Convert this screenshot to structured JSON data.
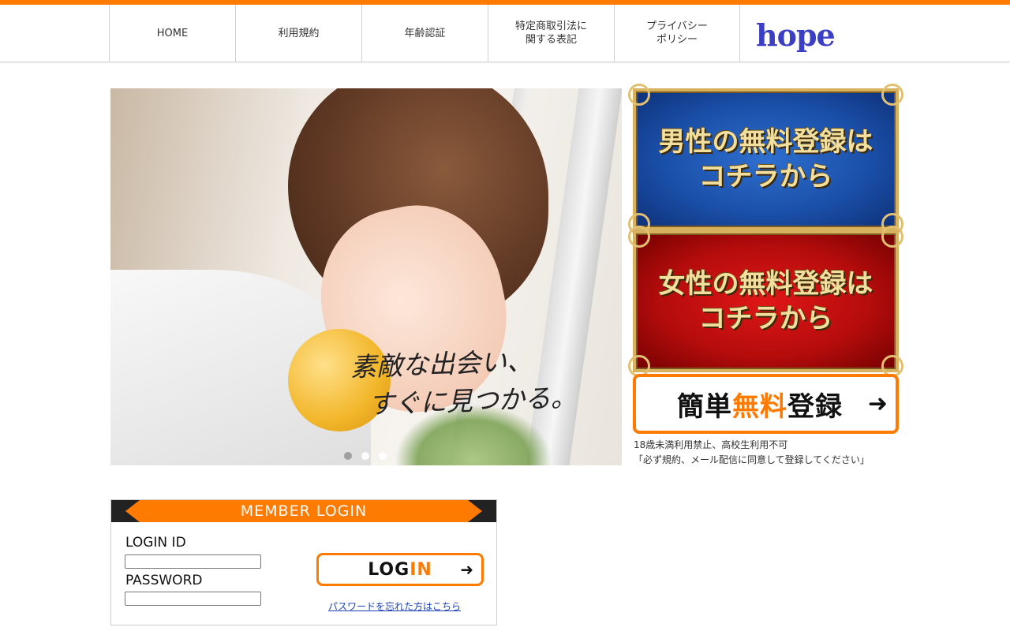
{
  "colors": {
    "accent": "#ff7a00",
    "logo": "#3b3fc4",
    "link": "#1a3fb5"
  },
  "nav": {
    "items": [
      {
        "label": "HOME"
      },
      {
        "label": "利用規約"
      },
      {
        "label": "年齢認証"
      },
      {
        "label": "特定商取引法に\n関する表記"
      },
      {
        "label": "プライバシー\nポリシー"
      }
    ],
    "logo": "hope"
  },
  "hero": {
    "catchcopy": "素敵な出会い、\n  すぐに見つかる。",
    "slide_count": 3,
    "active_slide": 1
  },
  "banners": {
    "male": "男性の無料登録は\nコチラから",
    "female": "女性の無料登録は\nコチラから"
  },
  "signup": {
    "label_pre": "簡単",
    "label_highlight": "無料",
    "label_post": "登録",
    "arrow_icon": "arrow-right-icon"
  },
  "notice": "18歳未満利用禁止、高校生利用不可\n「必ず規約、メール配信に同意して登録してください」",
  "login": {
    "title": "MEMBER LOGIN",
    "id_label": "LOGIN ID",
    "id_value": "",
    "password_label": "PASSWORD",
    "password_value": "",
    "button_pre": "LOG",
    "button_highlight": "IN",
    "forgot": "パスワードを忘れた方はこちら"
  }
}
